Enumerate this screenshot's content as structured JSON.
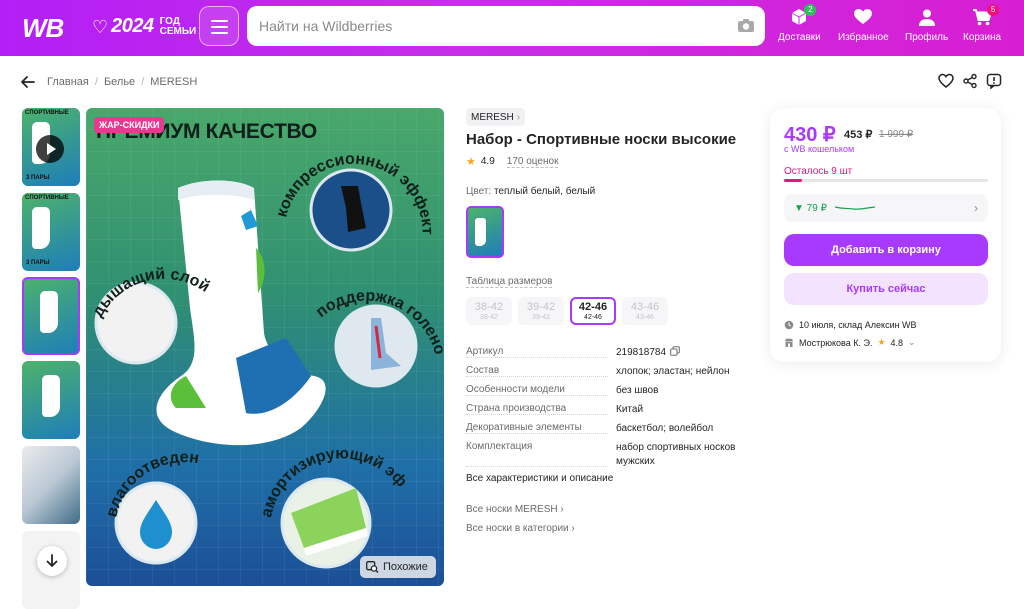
{
  "header": {
    "logo": "WB",
    "logo_year": "2024",
    "logo_tagline": "ГОД СЕМЬИ",
    "search_placeholder": "Найти на Wildberries",
    "nav": [
      {
        "label": "Доставки",
        "icon": "box-icon",
        "badge": "2"
      },
      {
        "label": "Избранное",
        "icon": "heart-icon"
      },
      {
        "label": "Профиль",
        "icon": "user-icon"
      },
      {
        "label": "Корзина",
        "icon": "cart-icon",
        "badge": "5"
      }
    ],
    "badge_colors": {
      "deliveries": "#2ebf5b",
      "cart": "#f1117e"
    }
  },
  "breadcrumb": [
    "Главная",
    "Белье",
    "MERESH"
  ],
  "gallery": {
    "thumb_text_1": "СПОРТИВНЫЕ",
    "thumb_pairs": "3 ПАРЫ",
    "promo_badge": "ЖАР-СКИДКИ",
    "headline": "ПРЕМИУМ КАЧЕСТВО",
    "features": [
      "компрессионный эффект",
      "дышащий слой",
      "поддержка голеностопа",
      "влагоотведение",
      "амортизирующий эффект"
    ],
    "similar_button": "Похожие"
  },
  "product": {
    "brand": "MERESH",
    "title": "Набор - Спортивные носки высокие",
    "rating": "4.9",
    "reviews": "170 оценок",
    "color_label": "Цвет:",
    "color_value": "теплый белый, белый",
    "size_table": "Таблица размеров",
    "sizes": [
      {
        "size": "38-42",
        "ru": "38-42",
        "active": false
      },
      {
        "size": "39-42",
        "ru": "39-42",
        "active": false
      },
      {
        "size": "42-46",
        "ru": "42-46",
        "active": true
      },
      {
        "size": "43-46",
        "ru": "43-46",
        "active": false
      }
    ],
    "specs": [
      {
        "k": "Артикул",
        "v": "219818784"
      },
      {
        "k": "Состав",
        "v": "хлопок; эластан; нейлон"
      },
      {
        "k": "Особенности модели",
        "v": "без швов"
      },
      {
        "k": "Страна производства",
        "v": "Китай"
      },
      {
        "k": "Декоративные элементы",
        "v": "баскетбол; волейбол"
      },
      {
        "k": "Комплектация",
        "v": "набор спортивных носков мужских"
      }
    ],
    "all_chars": "Все характеристики и описание",
    "link_brand": "Все носки MERESH",
    "link_category": "Все носки в категории"
  },
  "price_card": {
    "price": "430 ₽",
    "price_no_wallet": "453 ₽",
    "price_old": "1 999 ₽",
    "wallet_note": "с WB кошельком",
    "stock_left": "Осталось 9 шт",
    "stock_fraction": 0.09,
    "price_history": "▼ 79 ₽",
    "add_to_cart": "Добавить в корзину",
    "buy_now": "Купить сейчас",
    "delivery": "10 июля, склад Алексин WB",
    "seller": "Мострюкова К. Э.",
    "seller_rating": "4.8",
    "accent": "#a73afd",
    "alert": "#f1117e"
  }
}
